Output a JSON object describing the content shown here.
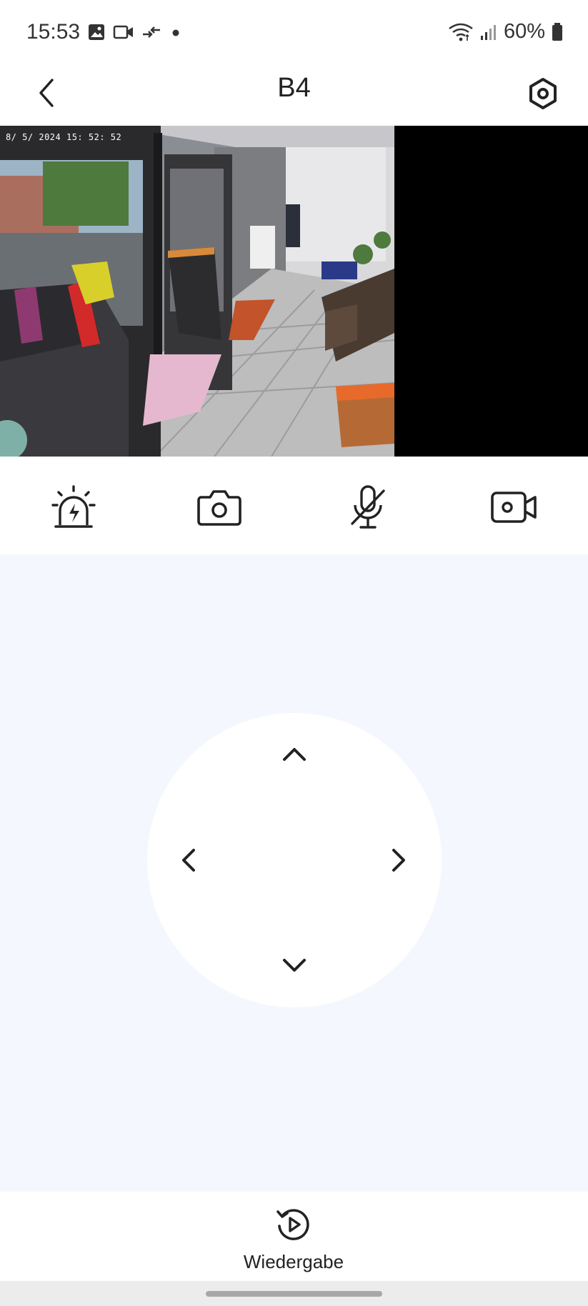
{
  "status_bar": {
    "time": "15:53",
    "battery": "60%",
    "icons": [
      "gallery-icon",
      "video-icon",
      "data-transfer-icon",
      "dot-icon",
      "wifi-icon",
      "signal-icon",
      "battery-icon"
    ]
  },
  "header": {
    "title": "B4",
    "back_icon": "chevron-left-icon",
    "settings_icon": "settings-hexagon-icon"
  },
  "video": {
    "timestamp": "8/ 5/ 2024  15: 52: 52"
  },
  "controls": [
    {
      "name": "alarm-siren-button",
      "icon": "siren-icon"
    },
    {
      "name": "snapshot-button",
      "icon": "camera-icon"
    },
    {
      "name": "microphone-button",
      "icon": "mic-off-icon"
    },
    {
      "name": "record-button",
      "icon": "video-camera-icon"
    }
  ],
  "ptz": {
    "up_icon": "chevron-up-icon",
    "down_icon": "chevron-down-icon",
    "left_icon": "chevron-left-icon",
    "right_icon": "chevron-right-icon"
  },
  "bottom": {
    "playback_label": "Wiedergabe",
    "playback_icon": "replay-icon"
  },
  "colors": {
    "ptz_background": "#f4f8fe",
    "icon": "#222222",
    "video_background": "#000000"
  }
}
